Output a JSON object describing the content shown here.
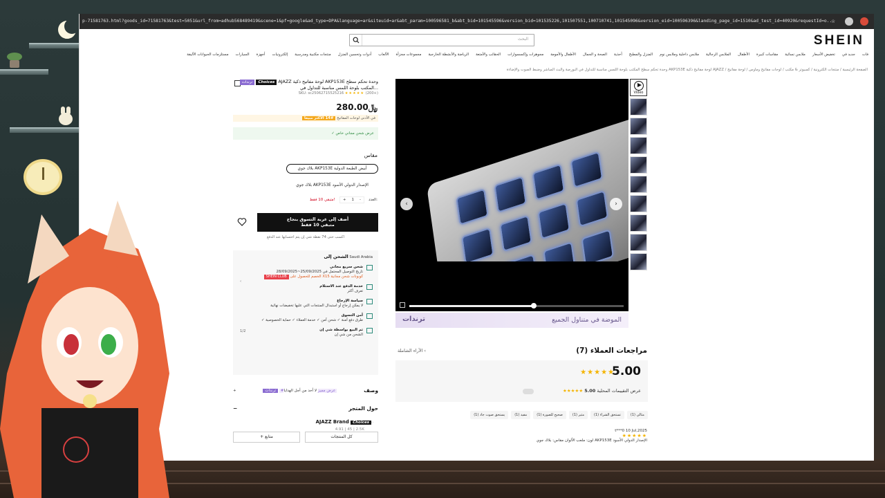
{
  "browser": {
    "url": "p-71581763.html?goods_id=71581763&test=5051&url_from=adhub568489419&scene=1&pf=google&ad_type=DPA&language=ar&siteuid=ar&abt_param=100596581_b&abt_bid=101545596&version_bid=101535226,101507551,100710741,101545096&version_eid=100596396&landing_page_id=1510&ad_test_id=40920&requestId=o..."
  },
  "header": {
    "logo": "SHEIN",
    "search_placeholder": "البحث",
    "nav": [
      "فات",
      "جديد في",
      "تخفيض الأسعار",
      "ملابس نسائية",
      "مقاسات كبيرة",
      "الأطفال",
      "الملابس الرجالية",
      "ملابس داخلية وملابس نوم",
      "المنزل والمطبخ",
      "أحذية",
      "الصحة و الجمال",
      "الأطفال والأمومة",
      "مجوهرات وإكسسوارات",
      "الحقائب والأمتعة",
      "الرياضة والأنشطة الخارجية",
      "مجموعات مجزأة",
      "الألعاب",
      "أدوات وتحسين المنزل",
      "منتجات مكتبية ومدرسية",
      "إلكترونيات",
      "أجهزة",
      "السيارات",
      "مستلزمات الحيوانات الأليفة"
    ],
    "breadcrumb": "الصفحة الرئيسية / منتجات الكترونية / كمبيوتر & مكتب / لوحات مفاتيح وماوس / لوحة مفاتيح / AJAZZ لوحة مفاتيح ذكية AKP153E وحدة تحكم سطح المكتب بلوحة اللمس مناسبة للتداول في البورصة والبث المباشر وضبط الصوت والإضاءة"
  },
  "gallery": {
    "video_label": "Video",
    "banner_left": "ترندات",
    "banner_right": "الموضة في متناول الجميع",
    "progress": 0.58
  },
  "product": {
    "badge_trend": "ترندات",
    "badge_choices": "Choices",
    "title": "AJAZZ لوحة مفاتيح ذكية AKP153E وحدة تحكم سطح المكتب بلوحة اللمس مناسبة للتداول في...",
    "sku": "SKU: sc25062715525216",
    "rating_count": "(200+)",
    "price": "280.00",
    "currency_symbol": "﷼",
    "bestseller_badge": "#14 الأكثر مبيعا",
    "bestseller_text": "في الأدنى لوحات المفاتيح",
    "shipping_banner": "✓ عرض شحن مجاني خاص",
    "size_label": "مقاس",
    "option_selected": "بلاك جوي AKP153E أبيض الطبعة الدولية",
    "option_other": "بلاك جوي AKP153E الإصدار الدولي الأسود",
    "qty_label": "العدد:",
    "qty_value": "1",
    "qty_minus": "-",
    "qty_plus": "+",
    "qty_warning": "متبقي 10 فقط!",
    "add_to_cart_line1": "أضف إلى عربة التسوق بنجاح",
    "add_to_cart_line2": "متبقي 10 فقط",
    "points_text": "اكسب حتى 74 نقطة شي إن يتم احتسابها عند الدفع"
  },
  "shipping": {
    "heading": "الشحن إلى",
    "country": "Saudi Arabia",
    "free_title": "شحن سريع مجاني",
    "free_date": "تاريخ التوصيل المحتمل في 25/09/2025~28/09/2025",
    "free_note": "الخصم للحصول على X15 كوبونات شحن مجانية",
    "club": "SHEIN CLUB",
    "cod_title": "خدمة الدفع عند الاستلام",
    "cod_sub": "تعرف أكثر",
    "return_title": "سياسة الإرجاع",
    "return_sub": "لا يمكن إرجاع أو استبدال المنتجات التي عليها تخفيضات نهائية",
    "secure_title": "أمن التسوق",
    "secure_items": "✓ طرق دفع آمنة  ✓ شحن آمن  ✓ خدمة العملاء  ✓ حماية الخصوصية",
    "pager": "1/2",
    "seller_title": "تم البيع بواسطة شي إن",
    "seller_sub": "الشحن من شي إن"
  },
  "description": {
    "title": "وصف",
    "badge": "ترندات",
    "tag": "#عرض مميز",
    "text": "لا أحد من أجل الهدايا"
  },
  "store": {
    "title": "حول المتجر",
    "collapse": "−",
    "choices": "Choices",
    "name": "AJAZZ Brand",
    "stats": "4.91  |  45  |  2.5K",
    "all_products": "كل المنتجات",
    "follow": "+ متابع"
  },
  "reviews": {
    "title": "مراجعات العملاء (7)",
    "all_reviews": "الآراء الشاملة ‹",
    "score": "5.00",
    "local_text": "عرض التقييمات المحلية",
    "local_score": "5.00",
    "tags": [
      "مثالي (1)",
      "تستحق الشراء (1)",
      "مثير (1)",
      "صحيح للصورة (1)",
      "مفيد (1)",
      "يستحق صوت جاد (1)"
    ],
    "date": "10 Jul,2025",
    "user": "t***0",
    "spec": "مقاس: بلاك جوي AKP153E الإصدار الدولي الأسود",
    "color": "لون: ملعب الألوان"
  },
  "colors": {
    "accent": "#8a6bd1",
    "star": "#f4b400",
    "warning": "#d0021b"
  }
}
